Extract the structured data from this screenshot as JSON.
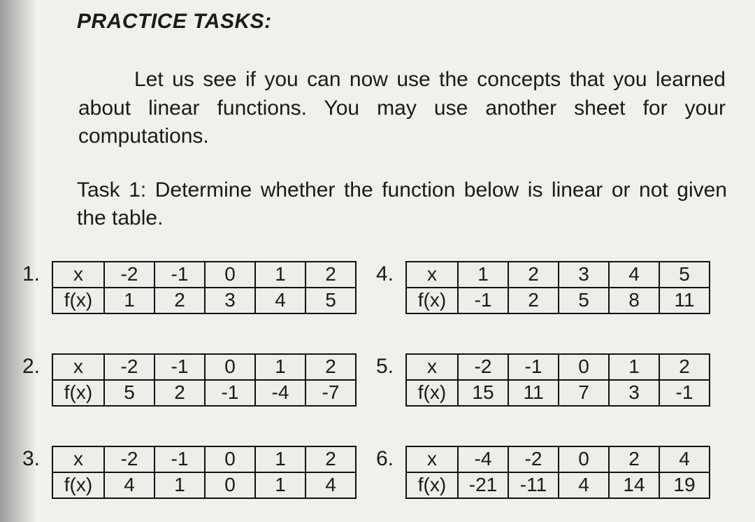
{
  "heading": "PRACTICE TASKS:",
  "intro": "Let us see if you can now use the concepts that you learned about linear functions. You may use another sheet for your computations.",
  "task": "Task 1: Determine whether the function below is linear or not given the table.",
  "rowHeaders": {
    "x": "x",
    "fx": "f(x)"
  },
  "tables": [
    {
      "num": "1.",
      "x": [
        "-2",
        "-1",
        "0",
        "1",
        "2"
      ],
      "fx": [
        "1",
        "2",
        "3",
        "4",
        "5"
      ]
    },
    {
      "num": "2.",
      "x": [
        "-2",
        "-1",
        "0",
        "1",
        "2"
      ],
      "fx": [
        "5",
        "2",
        "-1",
        "-4",
        "-7"
      ]
    },
    {
      "num": "3.",
      "x": [
        "-2",
        "-1",
        "0",
        "1",
        "2"
      ],
      "fx": [
        "4",
        "1",
        "0",
        "1",
        "4"
      ]
    },
    {
      "num": "4.",
      "x": [
        "1",
        "2",
        "3",
        "4",
        "5"
      ],
      "fx": [
        "-1",
        "2",
        "5",
        "8",
        "11"
      ]
    },
    {
      "num": "5.",
      "x": [
        "-2",
        "-1",
        "0",
        "1",
        "2"
      ],
      "fx": [
        "15",
        "11",
        "7",
        "3",
        "-1"
      ]
    },
    {
      "num": "6.",
      "x": [
        "-4",
        "-2",
        "0",
        "2",
        "4"
      ],
      "fx": [
        "-21",
        "-11",
        "4",
        "14",
        "19"
      ]
    }
  ]
}
